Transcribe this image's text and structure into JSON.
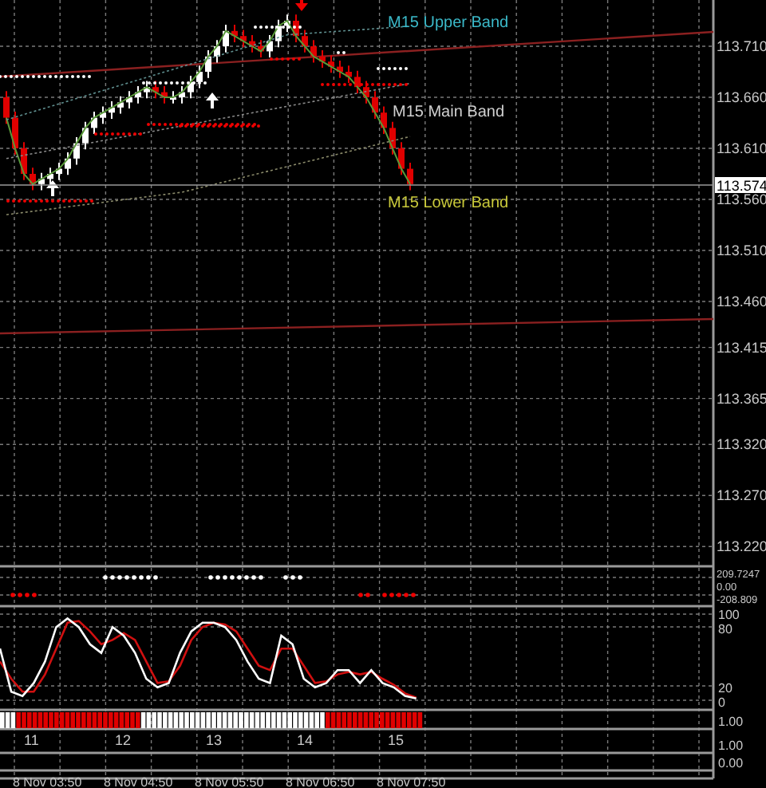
{
  "price_axis": [
    "113.710",
    "113.660",
    "113.610",
    "113.560",
    "113.510",
    "113.460",
    "113.415",
    "113.365",
    "113.320",
    "113.270",
    "113.220"
  ],
  "current_price": "113.574",
  "band_labels": [
    {
      "text": "M15 Upper Band",
      "color": "#3bb9c9"
    },
    {
      "text": "M15 Main Band",
      "color": "#d0d0d0"
    },
    {
      "text": "M15 Lower Band",
      "color": "#c8c83a"
    }
  ],
  "indicator_axis": [
    "209.7247",
    "0.00",
    "-208.809"
  ],
  "stochastic_axis": [
    "100",
    "80",
    "20",
    "0"
  ],
  "histogram_axis": [
    "1.00"
  ],
  "counter_axis": [
    "1.00"
  ],
  "bottom_axis": [
    "0.00"
  ],
  "counters": [
    "11",
    "12",
    "13",
    "14",
    "15"
  ],
  "time_axis": [
    "8 Nov 03:50",
    "8 Nov 04:50",
    "8 Nov 05:50",
    "8 Nov 06:50",
    "8 Nov 07:50"
  ]
}
